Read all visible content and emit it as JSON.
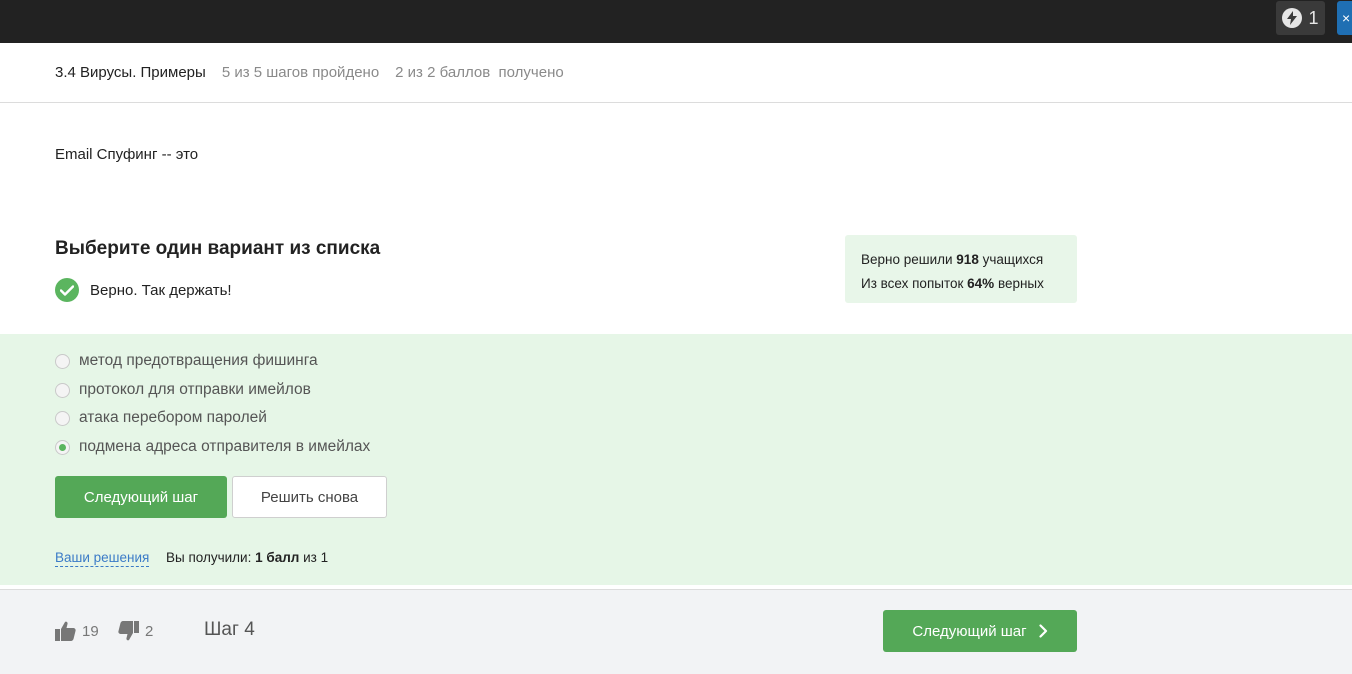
{
  "topbar": {
    "energy_count": "1",
    "close_glyph": "×"
  },
  "header": {
    "lesson_title": "3.4 Вирусы. Примеры",
    "steps_progress": "5 из 5 шагов пройдено",
    "points_progress": "2 из 2 баллов  получено"
  },
  "question": {
    "text": "Email Спуфинг -- это"
  },
  "task": {
    "title": "Выберите один вариант из списка",
    "result_text": "Верно. Так держать!"
  },
  "stats": {
    "line1_prefix": "Верно решили ",
    "line1_value": "918",
    "line1_suffix": " учащихся",
    "line2_prefix": "Из всех попыток ",
    "line2_value": "64%",
    "line2_suffix": " верных"
  },
  "options": [
    {
      "label": "метод предотвращения фишинга",
      "selected": false
    },
    {
      "label": "протокол для отправки имейлов",
      "selected": false
    },
    {
      "label": "атака перебором паролей",
      "selected": false
    },
    {
      "label": "подмена адреса отправителя в имейлах",
      "selected": true
    }
  ],
  "actions": {
    "next_label": "Следующий шаг",
    "retry_label": "Решить снова"
  },
  "submission": {
    "solutions_link": "Ваши решения",
    "score_prefix": "Вы получили: ",
    "score_value": "1 балл",
    "score_suffix": " из 1"
  },
  "footer": {
    "likes": "19",
    "dislikes": "2",
    "step_label": "Шаг 4",
    "next_label": "Следующий шаг"
  },
  "icons": {
    "energy": "lightning-icon",
    "check": "checkmark-icon",
    "like": "thumbs-up-icon",
    "dislike": "thumbs-down-icon",
    "next": "chevron-right-icon"
  },
  "colors": {
    "accent_green": "#54a857",
    "answer_bg": "#e6f6e7",
    "stats_bg": "#e8f6e9",
    "topbar_bg": "#222222",
    "link_blue": "#3b7bc7"
  }
}
